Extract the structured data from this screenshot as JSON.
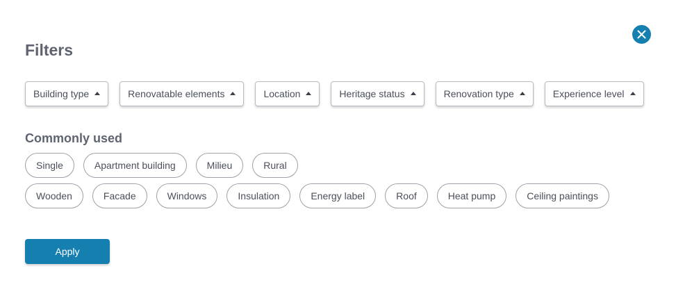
{
  "title": "Filters",
  "close_icon": "close-icon",
  "accent_color": "#1580b0",
  "dropdowns": [
    {
      "label": "Building type",
      "icon": "caret-up-icon"
    },
    {
      "label": "Renovatable elements",
      "icon": "caret-up-icon"
    },
    {
      "label": "Location",
      "icon": "caret-up-icon"
    },
    {
      "label": "Heritage status",
      "icon": "caret-up-icon"
    },
    {
      "label": "Renovation type",
      "icon": "caret-up-icon"
    },
    {
      "label": "Experience level",
      "icon": "caret-up-icon"
    }
  ],
  "commonly_used": {
    "title": "Commonly used",
    "row1": [
      "Single",
      "Apartment building",
      "Milieu",
      "Rural"
    ],
    "row2": [
      "Wooden",
      "Facade",
      "Windows",
      "Insulation",
      "Energy label",
      "Roof",
      "Heat pump",
      "Ceiling paintings"
    ]
  },
  "apply_label": "Apply"
}
